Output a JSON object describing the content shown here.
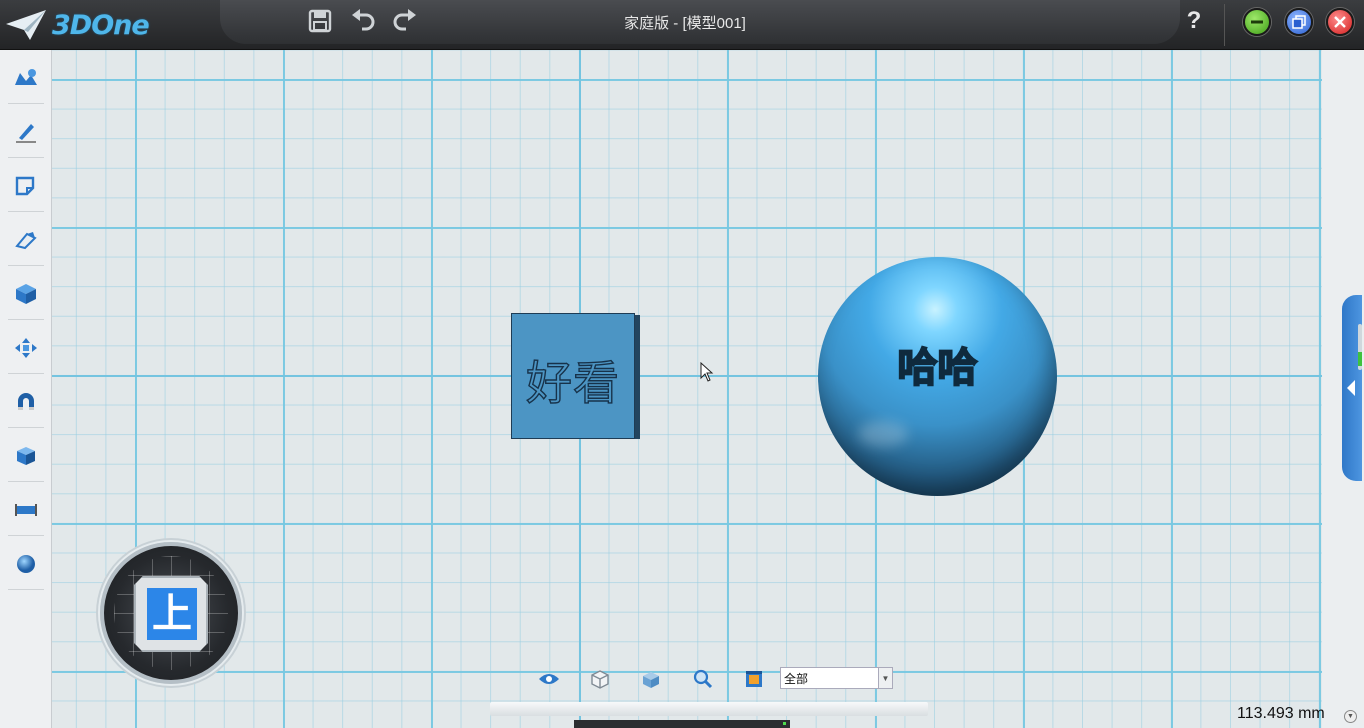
{
  "app": {
    "logo_text": "3DOne",
    "window_title": "家庭版 - [模型001]",
    "help_label": "?"
  },
  "toolbar_icons": [
    "save-icon",
    "undo-icon",
    "redo-icon"
  ],
  "left_toolbar": [
    "basic-solid-icon",
    "sketch-icon",
    "sketch-edit-icon",
    "special-feature-icon",
    "basic-edit-icon",
    "move-icon",
    "magnet-icon",
    "combine-icon",
    "distance-measure-icon",
    "material-icon"
  ],
  "scene": {
    "box_label": "好看",
    "sphere_label": "哈哈",
    "view_cube_label": "上"
  },
  "bottom_toolbar": {
    "icons": [
      "view-eye-icon",
      "wireframe-cube-icon",
      "shaded-cube-icon",
      "zoom-icon",
      "render-icon"
    ],
    "filter_value": "全部"
  },
  "status": {
    "measure": "113.493 mm"
  },
  "colors": {
    "accent": "#2c86e8",
    "grid_major": "#78c8e1",
    "box": "#4c95c4",
    "sphere": "#3a91c8"
  }
}
